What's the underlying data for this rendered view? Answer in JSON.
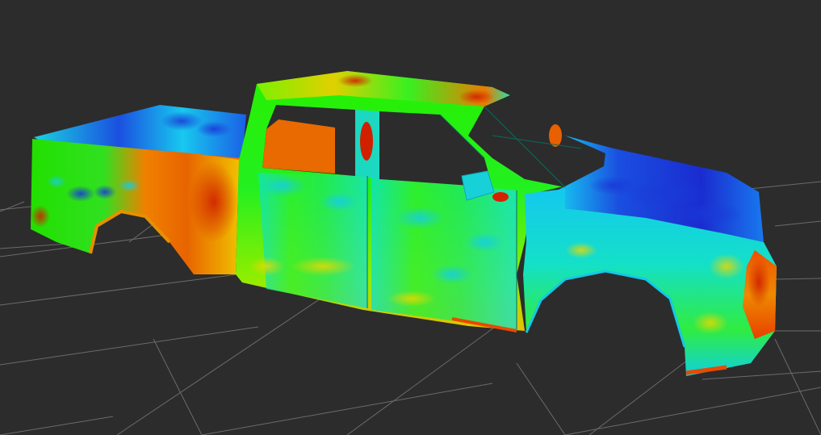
{
  "viewport": {
    "background_color": "#2c2c2c",
    "grid_color": "#6b6b6b"
  },
  "model": {
    "object": "pickup-truck-body",
    "colormap": "jet",
    "colors": [
      "#1a2fd6",
      "#1c8cf0",
      "#12d8e6",
      "#19e84a",
      "#22f000",
      "#c8f000",
      "#f0c800",
      "#f07800",
      "#e83c00",
      "#c01c00"
    ]
  }
}
